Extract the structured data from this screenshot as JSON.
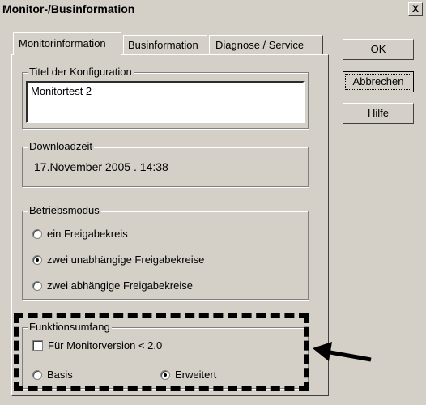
{
  "window": {
    "title": "Monitor-/Businformation",
    "close_label": "X"
  },
  "tabs": [
    {
      "label": "Monitorinformation",
      "accel": "M"
    },
    {
      "label": "Businformation",
      "accel": "B"
    },
    {
      "label": "Diagnose / Service",
      "accel": ""
    }
  ],
  "config_title": {
    "label": "Titel der Konfiguration",
    "value": "Monitortest 2"
  },
  "download": {
    "label": "Downloadzeit",
    "value": "17.November 2005  .  14:38"
  },
  "mode": {
    "label": "Betriebsmodus",
    "options": [
      {
        "label": "ein Freigabekreis",
        "selected": false
      },
      {
        "label": "zwei unabhängige Freigabekreise",
        "selected": true
      },
      {
        "label": "zwei abhängige Freigabekreise",
        "selected": false
      }
    ]
  },
  "scope": {
    "label": "Funktionsumfang",
    "checkbox_label": "Für Monitorversion < 2.0",
    "checkbox_checked": false,
    "options": [
      {
        "label": "Basis",
        "selected": false
      },
      {
        "label": "Erweitert",
        "selected": true
      }
    ]
  },
  "buttons": {
    "ok": "OK",
    "cancel": "Abbrechen",
    "help": "Hilfe"
  }
}
